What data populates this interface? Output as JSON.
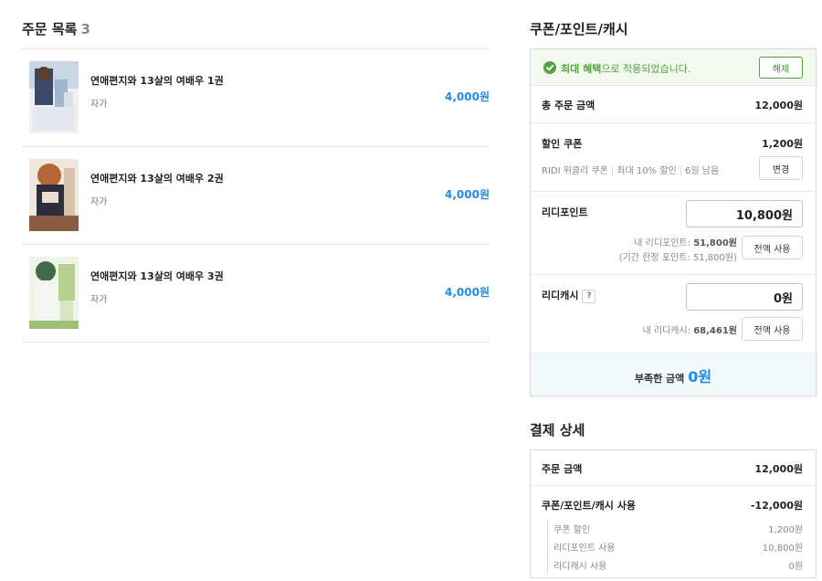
{
  "order": {
    "title": "주문 목록",
    "count": "3",
    "items": [
      {
        "title": "연애편지와 13살의 여배우 1권",
        "author": "자가",
        "price": "4,000원"
      },
      {
        "title": "연애편지와 13살의 여배우 2권",
        "author": "자가",
        "price": "4,000원"
      },
      {
        "title": "연애편지와 13살의 여배우 3권",
        "author": "자가",
        "price": "4,000원"
      }
    ]
  },
  "discount": {
    "title": "쿠폰/포인트/캐시",
    "benefit_strong": "최대 혜택",
    "benefit_rest": "으로 적용되었습니다.",
    "cancel_label": "해제",
    "total_label": "총 주문 금액",
    "total_value": "12,000원",
    "coupon_label": "할인 쿠폰",
    "coupon_value": "1,200원",
    "coupon_desc_name": "RIDI 위클리 쿠폰",
    "coupon_desc_rate": "최대 10% 할인",
    "coupon_desc_days": "6일 남음",
    "coupon_change_label": "변경",
    "point_label": "리디포인트",
    "point_input": "10,800원",
    "point_hint_prefix": "내 리디포인트:",
    "point_hint_value": "51,800원",
    "point_hint_limited": "(기간 한정 포인트: 51,800원)",
    "point_use_all": "전액 사용",
    "cash_label": "리디캐시",
    "cash_help": "?",
    "cash_input": "0원",
    "cash_hint_prefix": "내 리디캐시:",
    "cash_hint_value": "68,461원",
    "cash_use_all": "전액 사용",
    "shortage_label": "부족한 금액",
    "shortage_value": "0원"
  },
  "payment": {
    "title": "결제 상세",
    "order_amount_label": "주문 금액",
    "order_amount_value": "12,000원",
    "used_label": "쿠폰/포인트/캐시 사용",
    "used_value": "-12,000원",
    "breakdown": [
      {
        "label": "쿠폰 할인",
        "value": "1,200원"
      },
      {
        "label": "리디포인트 사용",
        "value": "10,800원"
      },
      {
        "label": "리디캐시 사용",
        "value": "0원"
      }
    ]
  },
  "colors": {
    "accent_blue": "#1f8ce6",
    "success_green": "#53a342"
  },
  "icons": {
    "benefit": "check-circle-icon",
    "covers": "book-cover-image"
  }
}
